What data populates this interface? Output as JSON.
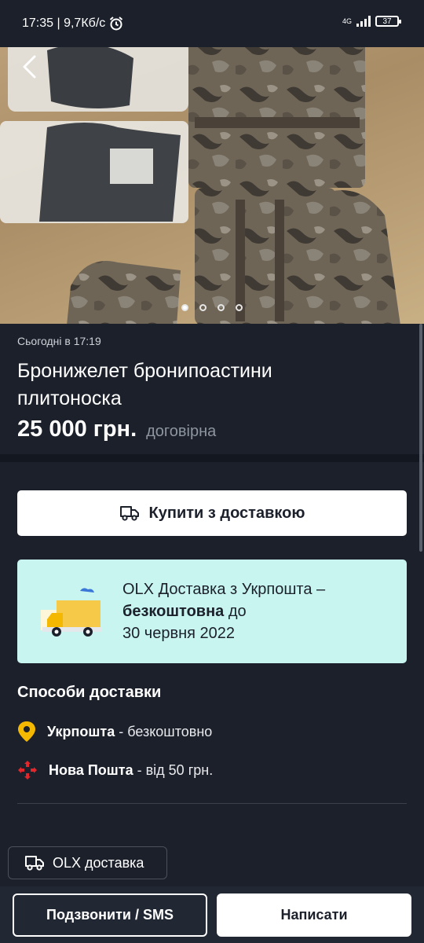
{
  "status_bar": {
    "time_speed": "17:35 | 9,7Кб/с",
    "network": "4G",
    "battery": "37"
  },
  "gallery": {
    "image_count": 4,
    "active_index": 0
  },
  "listing": {
    "posted": "Сьогодні в 17:19",
    "title": "Бронижелет бронипоастини плитоноска",
    "price": "25 000 грн.",
    "negotiable": "договірна"
  },
  "buy_button": {
    "label": "Купити з доставкою"
  },
  "promo": {
    "line1": "OLX Доставка з Укрпошта –",
    "bold": "безкоштовна",
    "line2_rest": " до",
    "line3": "30 червня 2022"
  },
  "delivery": {
    "title": "Способи доставки",
    "methods": [
      {
        "name": "Укрпошта",
        "detail": " - безкоштовно"
      },
      {
        "name": "Нова Пошта",
        "detail": " - від 50 грн."
      }
    ]
  },
  "chip": {
    "label": "OLX доставка"
  },
  "actions": {
    "call": "Подзвонити / SMS",
    "message": "Написати"
  },
  "colors": {
    "background": "#1b202b",
    "promo_bg": "#c9f5f0",
    "ukrposhta": "#f5b800",
    "novaposhta": "#e3262c"
  }
}
